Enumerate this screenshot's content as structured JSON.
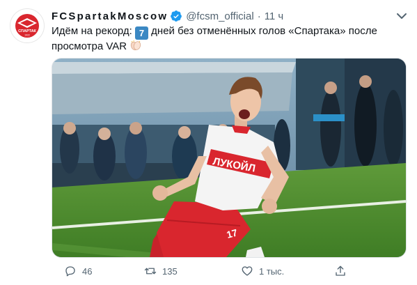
{
  "tweet": {
    "author": {
      "display_name": "FCSpartakMoscow",
      "handle": "@fcsm_official",
      "separator": "·",
      "time": "11 ч",
      "avatar_label": "СПАРТАК",
      "avatar_year": "1922"
    },
    "text": {
      "before_keycap": "Идём на рекорд: ",
      "keycap": "7",
      "after_keycap": " дней без отменённых голов «Спартака» после просмотра VAR",
      "emoji": "clapping-hands-icon"
    },
    "media": {
      "shirt_sponsor": "ЛУКОЙЛ",
      "shirt_number": "17"
    },
    "actions": {
      "replies": "46",
      "retweets": "135",
      "likes": "1 тыс."
    }
  },
  "colors": {
    "verified_blue": "#1d9bf0",
    "muted_text": "#536471",
    "spartak_red": "#d9262e"
  }
}
